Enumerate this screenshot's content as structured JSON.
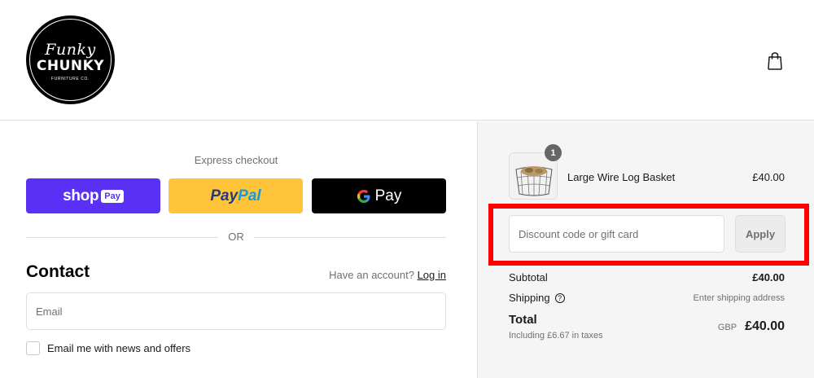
{
  "brand": {
    "script": "Funky",
    "main": "CHUNKY",
    "sub": "FURNITURE CO."
  },
  "icons": {
    "cart": "shopping-bag-icon",
    "help": "question-circle-icon"
  },
  "express": {
    "label": "Express checkout",
    "shop_pay": {
      "word": "shop",
      "badge": "Pay",
      "color": "#5a31f4"
    },
    "paypal": {
      "part1": "Pay",
      "part2": "Pal",
      "color": "#ffc439"
    },
    "gpay": {
      "g": "G",
      "text": "Pay",
      "color": "#000000"
    },
    "divider": "OR"
  },
  "contact": {
    "title": "Contact",
    "account_prompt": "Have an account?",
    "login_label": "Log in",
    "email_placeholder": "Email",
    "newsletter_label": "Email me with news and offers",
    "newsletter_checked": false
  },
  "order": {
    "item": {
      "name": "Large Wire Log Basket",
      "price": "£40.00",
      "quantity": "1"
    },
    "discount_placeholder": "Discount code or gift card",
    "apply_label": "Apply",
    "subtotal_label": "Subtotal",
    "subtotal_value": "£40.00",
    "shipping_label": "Shipping",
    "shipping_value": "Enter shipping address",
    "total_label": "Total",
    "taxes_note": "Including £6.67 in taxes",
    "currency": "GBP",
    "total_value": "£40.00"
  },
  "colors": {
    "highlight": "#ff0000",
    "summary_bg": "#f5f5f5"
  }
}
